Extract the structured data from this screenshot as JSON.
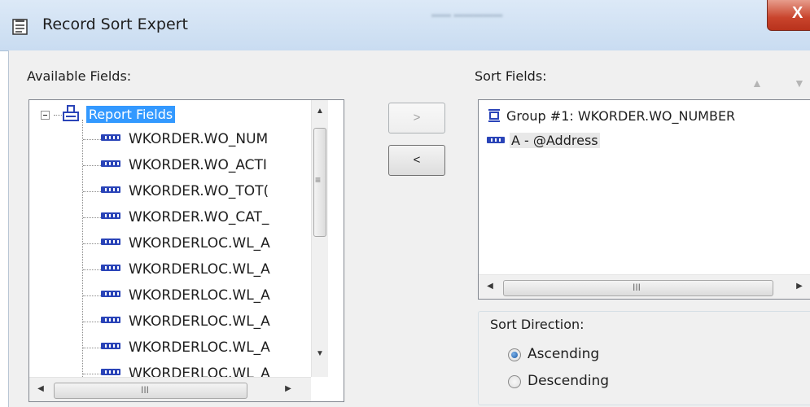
{
  "window": {
    "title": "Record Sort Expert",
    "close_glyph": "X",
    "title_icon": "record-sort-icon"
  },
  "available": {
    "label": "Available Fields:",
    "root": "Report Fields",
    "items": [
      "WKORDER.WO_NUM",
      "WKORDER.WO_ACTI",
      "WKORDER.WO_TOT(",
      "WKORDER.WO_CAT_",
      "WKORDERLOC.WL_A",
      "WKORDERLOC.WL_A",
      "WKORDERLOC.WL_A",
      "WKORDERLOC.WL_A",
      "WKORDERLOC.WL_A",
      "WKORDERLOC.WL_A"
    ]
  },
  "buttons": {
    "add": ">",
    "remove": "<"
  },
  "sort": {
    "label": "Sort Fields:",
    "items": [
      "Group #1: WKORDER.WO_NUMBER",
      "A - @Address"
    ]
  },
  "direction": {
    "label": "Sort Direction:",
    "options": [
      "Ascending",
      "Descending"
    ],
    "selected": "Ascending"
  },
  "scroll": {
    "grip": "III",
    "vgrip": "≡"
  },
  "colors": {
    "selection": "#3399ff",
    "field_icon": "#2a44b8"
  }
}
